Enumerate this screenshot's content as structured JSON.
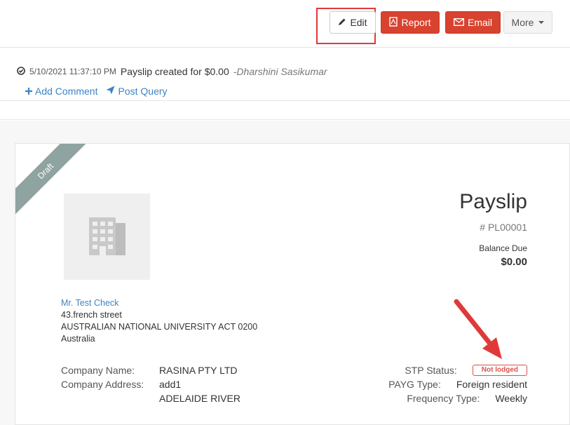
{
  "toolbar": {
    "edit_label": "Edit",
    "report_label": "Report",
    "email_label": "Email",
    "more_label": "More"
  },
  "activity": {
    "timestamp": "5/10/2021 11:37:10 PM",
    "message": "Payslip created for $0.00",
    "separator": " - ",
    "user": "Dharshini Sasikumar",
    "add_comment": "Add Comment",
    "post_query": "Post Query"
  },
  "document": {
    "status_ribbon": "Draft",
    "title": "Payslip",
    "number": "# PL00001",
    "balance_label": "Balance Due",
    "balance_value": "$0.00",
    "address": {
      "name": "Mr. Test Check",
      "line1": "43.french street",
      "line2": "AUSTRALIAN NATIONAL UNIVERSITY ACT 0200",
      "line3": "Australia"
    },
    "company_name_label": "Company Name:",
    "company_name_value": "RASINA PTY LTD",
    "company_address_label": "Company Address:",
    "company_address_line1": "add1",
    "company_address_line2": "ADELAIDE RIVER",
    "stp_label": "STP Status:",
    "stp_value": "Not lodged",
    "payg_label": "PAYG Type:",
    "payg_value": "Foreign resident",
    "frequency_label": "Frequency Type:",
    "frequency_value": "Weekly"
  },
  "colors": {
    "accent_red": "#d8432f",
    "link_blue": "#3d84c5",
    "ribbon_gray": "#8fa3a1",
    "annotation_red": "#e0393a"
  },
  "icons": {
    "edit": "pencil-icon",
    "report": "pdf-file-icon",
    "email": "envelope-icon",
    "activity": "check-circle-icon",
    "add_comment": "plus-icon",
    "post_query": "paper-plane-icon",
    "logo": "building-icon"
  }
}
